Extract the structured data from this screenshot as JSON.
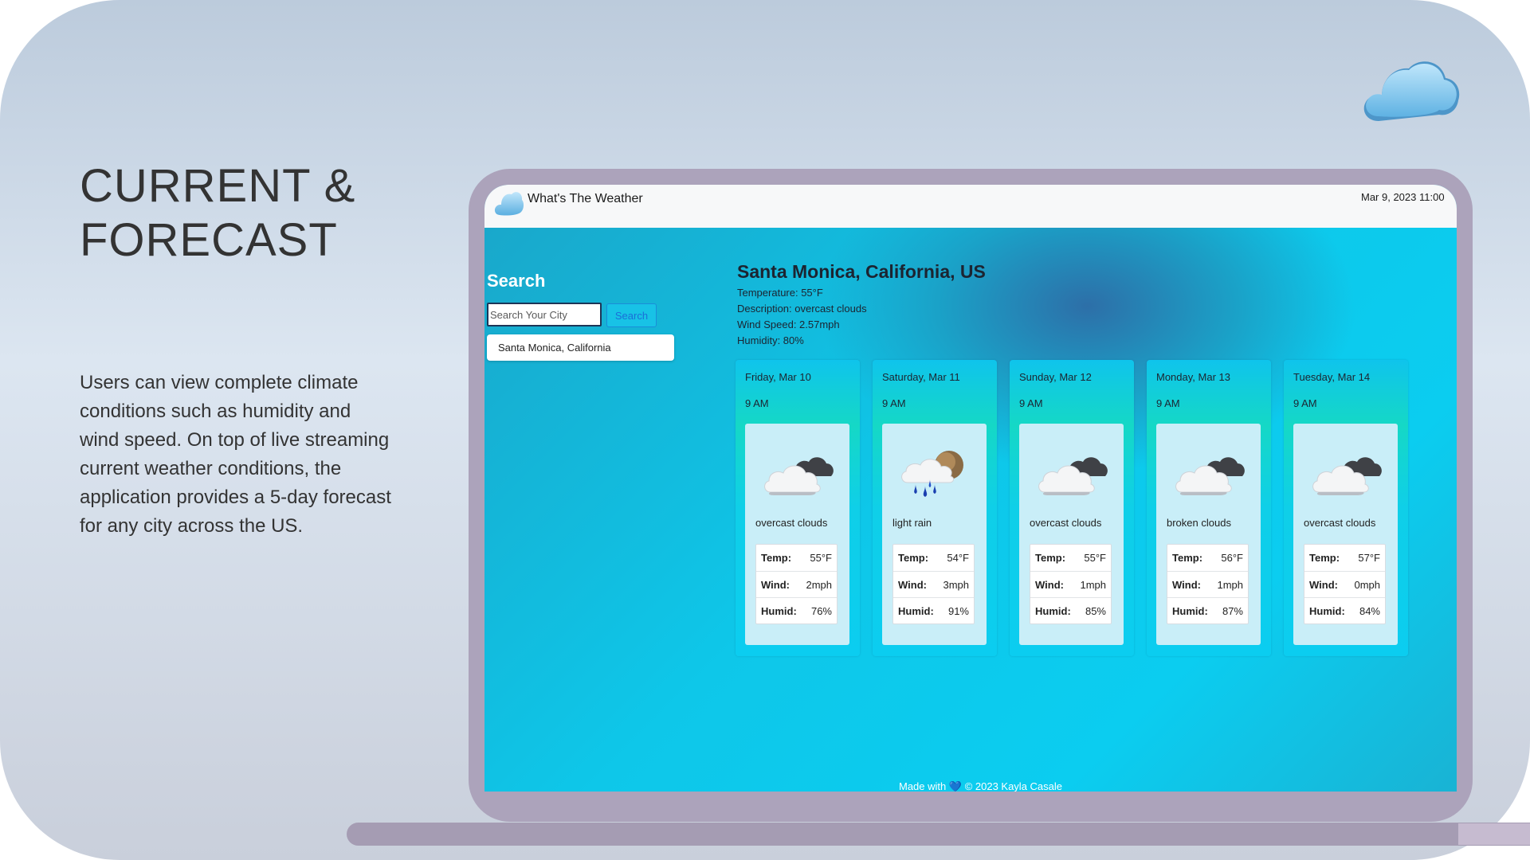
{
  "slide": {
    "heading": [
      "CURRENT &",
      "FORECAST"
    ],
    "description": [
      "Users can view complete climate",
      "conditions such as humidity and",
      "wind speed. On top of live streaming",
      "current weather conditions, the",
      "application provides a 5-day forecast",
      "for any city across the US."
    ],
    "decor_icon": "cloud-icon"
  },
  "app": {
    "title": "What's The Weather",
    "logo_icon": "cloud-icon",
    "datetime": "Mar 9, 2023   11:00",
    "search": {
      "title": "Search",
      "placeholder": "Search Your City",
      "button_label": "Search",
      "suggestion": "Santa Monica, California"
    },
    "current": {
      "city": "Santa Monica, California, US",
      "temperature": "Temperature: 55°F",
      "description": "Description: overcast clouds",
      "wind": "Wind Speed: 2.57mph",
      "humidity": "Humidity: 80%"
    },
    "labels": {
      "temp": "Temp:",
      "wind": "Wind:",
      "humid": "Humid:"
    },
    "forecast": [
      {
        "date": "Friday, Mar 10",
        "time": "9 AM",
        "icon": "overcast-clouds-icon",
        "desc": "overcast clouds",
        "temp": "55°F",
        "wind": "2mph",
        "humid": "76%"
      },
      {
        "date": "Saturday, Mar 11",
        "time": "9 AM",
        "icon": "light-rain-icon",
        "desc": "light rain",
        "temp": "54°F",
        "wind": "3mph",
        "humid": "91%"
      },
      {
        "date": "Sunday, Mar 12",
        "time": "9 AM",
        "icon": "overcast-clouds-icon",
        "desc": "overcast clouds",
        "temp": "55°F",
        "wind": "1mph",
        "humid": "85%"
      },
      {
        "date": "Monday, Mar 13",
        "time": "9 AM",
        "icon": "broken-clouds-icon",
        "desc": "broken clouds",
        "temp": "56°F",
        "wind": "1mph",
        "humid": "87%"
      },
      {
        "date": "Tuesday, Mar 14",
        "time": "9 AM",
        "icon": "overcast-clouds-icon",
        "desc": "overcast clouds",
        "temp": "57°F",
        "wind": "0mph",
        "humid": "84%"
      }
    ],
    "footer": {
      "prefix": "Made with",
      "heart": "💙",
      "suffix": "© 2023 Kayla Casale"
    }
  },
  "colors": {
    "accent": "#0bcdf0",
    "frame": "#aca3bb",
    "text": "#333333"
  }
}
